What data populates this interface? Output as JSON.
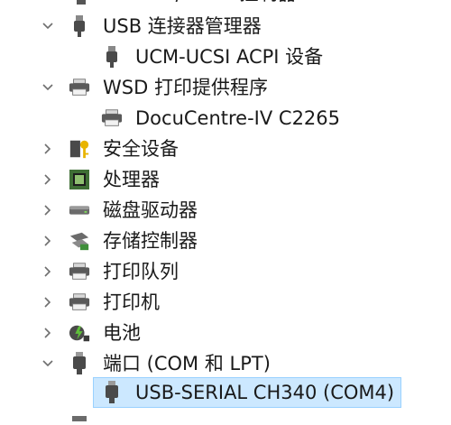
{
  "tree": {
    "top_partial": {
      "label": "IDE ATA/ATAPI 控制器"
    },
    "usb_controllers": {
      "label": "USB 连接器管理器",
      "expanded": true,
      "icon": "usb-plug-icon"
    },
    "ucm_ucsi": {
      "label": "UCM-UCSI ACPI 设备",
      "icon": "usb-plug-icon"
    },
    "wsd_print": {
      "label": "WSD 打印提供程序",
      "expanded": true,
      "icon": "printer-icon"
    },
    "docucentre": {
      "label": "DocuCentre-IV C2265",
      "icon": "printer-icon"
    },
    "security": {
      "label": "安全设备",
      "expanded": false,
      "icon": "security-key-icon"
    },
    "processors": {
      "label": "处理器",
      "expanded": false,
      "icon": "processor-chip-icon"
    },
    "disk_drives": {
      "label": "磁盘驱动器",
      "expanded": false,
      "icon": "disk-drive-icon"
    },
    "storage_controllers": {
      "label": "存储控制器",
      "expanded": false,
      "icon": "storage-controller-icon"
    },
    "print_queues": {
      "label": "打印队列",
      "expanded": false,
      "icon": "printer-icon"
    },
    "printers": {
      "label": "打印机",
      "expanded": false,
      "icon": "printer-icon"
    },
    "batteries": {
      "label": "电池",
      "expanded": false,
      "icon": "battery-icon"
    },
    "ports": {
      "label": "端口 (COM 和 LPT)",
      "expanded": true,
      "icon": "port-connector-icon"
    },
    "usb_serial": {
      "label": "USB-SERIAL CH340 (COM4)",
      "selected": true,
      "icon": "port-connector-icon"
    }
  },
  "colors": {
    "selection_bg": "#cce8ff",
    "selection_border": "#99d1ff",
    "chevron": "#6e6e6e"
  }
}
